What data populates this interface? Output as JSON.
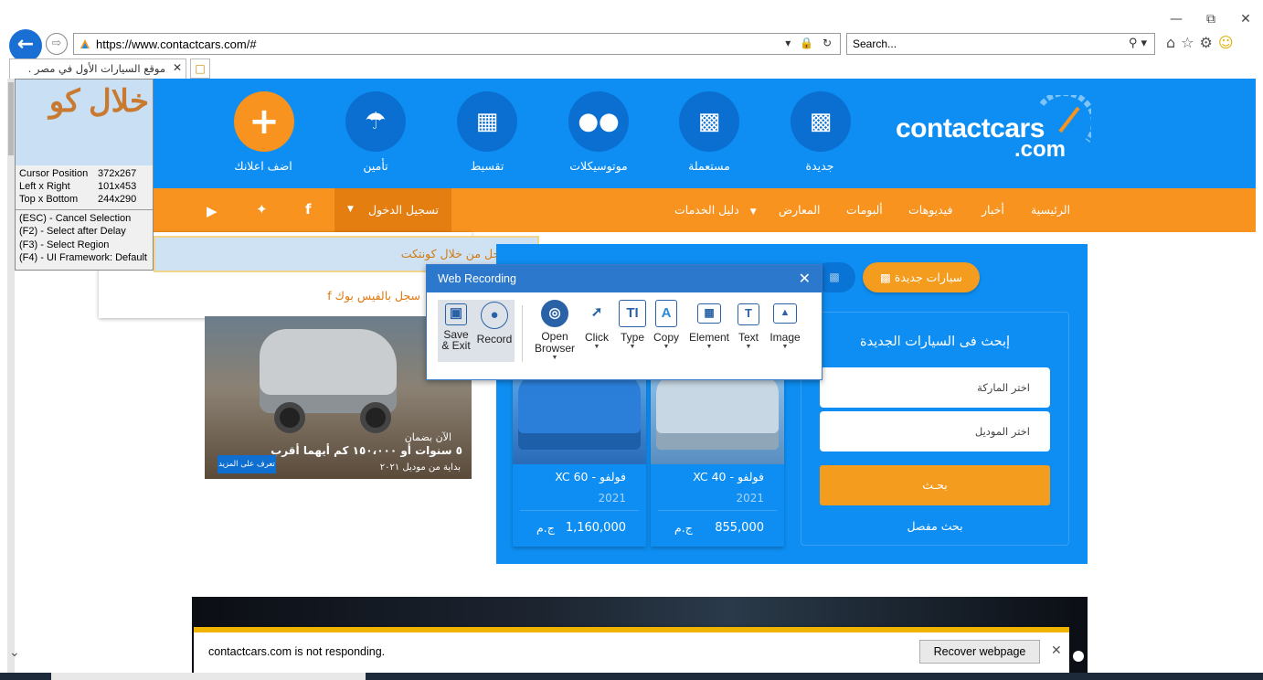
{
  "browser": {
    "window_controls": {
      "minimize": "—",
      "restore": "⧉",
      "close": "✕"
    },
    "url": "https://www.contactcars.com/#",
    "search_placeholder": "Search...",
    "tab_title": "موقع السيارات الأول في مصر ...",
    "tab_close": "✕"
  },
  "site": {
    "logo": {
      "word1": "contactcars",
      "word2": ".com"
    },
    "nav_icons": [
      {
        "label": "جديدة",
        "icon": "car-new-icon"
      },
      {
        "label": "مستعملة",
        "icon": "car-used-icon"
      },
      {
        "label": "موتوسيكلات",
        "icon": "motorcycle-icon"
      },
      {
        "label": "تقسيط",
        "icon": "calculator-icon"
      },
      {
        "label": "تأمين",
        "icon": "umbrella-icon"
      },
      {
        "label": "اضف اعلانك",
        "icon": "plus-icon"
      }
    ],
    "menu": [
      "الرئيسية",
      "أخبار",
      "فيديوهات",
      "ألبومات",
      "المعارض",
      "دليل الخدمات"
    ],
    "login": "تسجيل الدخول",
    "social": [
      "f",
      "twitter-icon",
      "youtube-icon"
    ],
    "login_dropdown": {
      "option1": "سجل من خلال كونتكت",
      "option2": "سجل بالفيس بوك"
    },
    "ad": {
      "line1": "الآن بضمان",
      "line2": "٥ سنوات أو ١٥٠،٠٠٠ كم أيهما أقرب",
      "line3": "بداية من موديل ٢٠٢١",
      "more": "تعرف على المزيد"
    },
    "widget": {
      "tab_new": "سيارات جديدة",
      "title": "إبحث فى السيارات الجديدة",
      "brand_placeholder": "اختر الماركة",
      "model_placeholder": "اختر الموديل",
      "search_button": "بحـث",
      "advanced": "بحث مفصل",
      "cards": [
        {
          "name": "فولفو - XC 40",
          "year": "2021",
          "price": "855,000",
          "currency": "ج.م"
        },
        {
          "name": "فولفو - XC 60",
          "year": "2021",
          "price": "1,160,000",
          "currency": "ج.م"
        }
      ]
    }
  },
  "magnifier": {
    "zoom_text": "خلال كو",
    "rows": [
      {
        "k": "Cursor Position",
        "v": "372x267"
      },
      {
        "k": "Left x Right",
        "v": "101x453"
      },
      {
        "k": "Top x Bottom",
        "v": "244x290"
      }
    ],
    "keys": [
      "(ESC) - Cancel Selection",
      "(F2)    - Select after Delay",
      "(F3)    - Select Region",
      "(F4)    - UI Framework: Default"
    ]
  },
  "recorder": {
    "title": "Web Recording",
    "tools": [
      {
        "label": "Save & Exit",
        "icon": "save-icon"
      },
      {
        "label": "Record",
        "icon": "record-icon"
      },
      {
        "label": "Open Browser",
        "icon": "globe-icon"
      },
      {
        "label": "Click",
        "icon": "click-icon"
      },
      {
        "label": "Type",
        "icon": "type-icon"
      },
      {
        "label": "Copy",
        "icon": "copy-icon"
      },
      {
        "label": "Element",
        "icon": "element-icon"
      },
      {
        "label": "Text",
        "icon": "text-icon"
      },
      {
        "label": "Image",
        "icon": "image-icon"
      }
    ]
  },
  "not_responding": {
    "message": "contactcars.com is not responding.",
    "button": "Recover webpage"
  }
}
